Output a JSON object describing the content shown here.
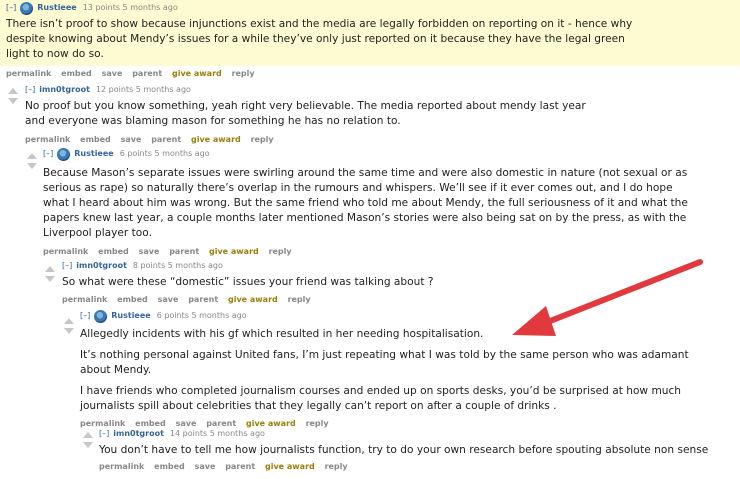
{
  "ui": {
    "toggle": "[–]"
  },
  "comments": [
    {
      "author": "Rustieee",
      "meta": "13 points 5 months ago",
      "paragraphs": [
        "There isn’t proof to show because injunctions exist and the media are legally forbidden on reporting on it - hence why despite knowing about Mendy’s issues for a while they’ve only just reported on it because they have the legal green light to now do so."
      ],
      "actions": [
        "permalink",
        "embed",
        "save",
        "parent",
        "give award",
        "reply"
      ]
    },
    {
      "author": "imn0tgroot",
      "meta": "12 points 5 months ago",
      "paragraphs": [
        "No proof but you know something, yeah right very believable. The media reported about mendy last year and everyone was blaming mason for something he has no relation to."
      ],
      "actions": [
        "permalink",
        "embed",
        "save",
        "parent",
        "give award",
        "reply"
      ]
    },
    {
      "author": "Rustieee",
      "meta": "6 points 5 months ago",
      "paragraphs": [
        "Because Mason’s separate issues were swirling around the same time and were also domestic in nature (not sexual or as serious as rape) so naturally there’s overlap in the rumours and whispers. We’ll see if it ever comes out, and I do hope what I heard about him was wrong. But the same friend who told me about Mendy, the full seriousness of it and what the papers knew last year, a couple months later mentioned Mason’s stories were also being sat on by the press, as with the Liverpool player too."
      ],
      "actions": [
        "permalink",
        "embed",
        "save",
        "parent",
        "give award",
        "reply"
      ]
    },
    {
      "author": "imn0tgroot",
      "meta": "8 points 5 months ago",
      "paragraphs": [
        "So what were these “domestic” issues your friend was talking about ?"
      ],
      "actions": [
        "permalink",
        "embed",
        "save",
        "parent",
        "give award",
        "reply"
      ]
    },
    {
      "author": "Rustieee",
      "meta": "6 points 5 months ago",
      "paragraphs": [
        "Allegedly incidents with his gf which resulted in her needing hospitalisation.",
        "It’s nothing personal against United fans, I’m just repeating what I was told by the same person who was adamant about Mendy.",
        "I have friends who completed journalism courses and ended up on sports desks, you’d be surprised at how much journalists spill about celebrities that they legally can’t report on after a couple of drinks ."
      ],
      "actions": [
        "permalink",
        "embed",
        "save",
        "parent",
        "give award",
        "reply"
      ]
    },
    {
      "author": "imn0tgroot",
      "meta": "14 points 5 months ago",
      "paragraphs": [
        "You don’t have to tell me how journalists function, try to do your own research before spouting absolute non sense"
      ],
      "actions": [
        "permalink",
        "embed",
        "save",
        "parent",
        "give award",
        "reply"
      ]
    }
  ],
  "colors": {
    "highlight": "#fefbd2",
    "author": "#336699",
    "award": "#9a7d0a",
    "annotation_arrow": "#e0393e"
  }
}
